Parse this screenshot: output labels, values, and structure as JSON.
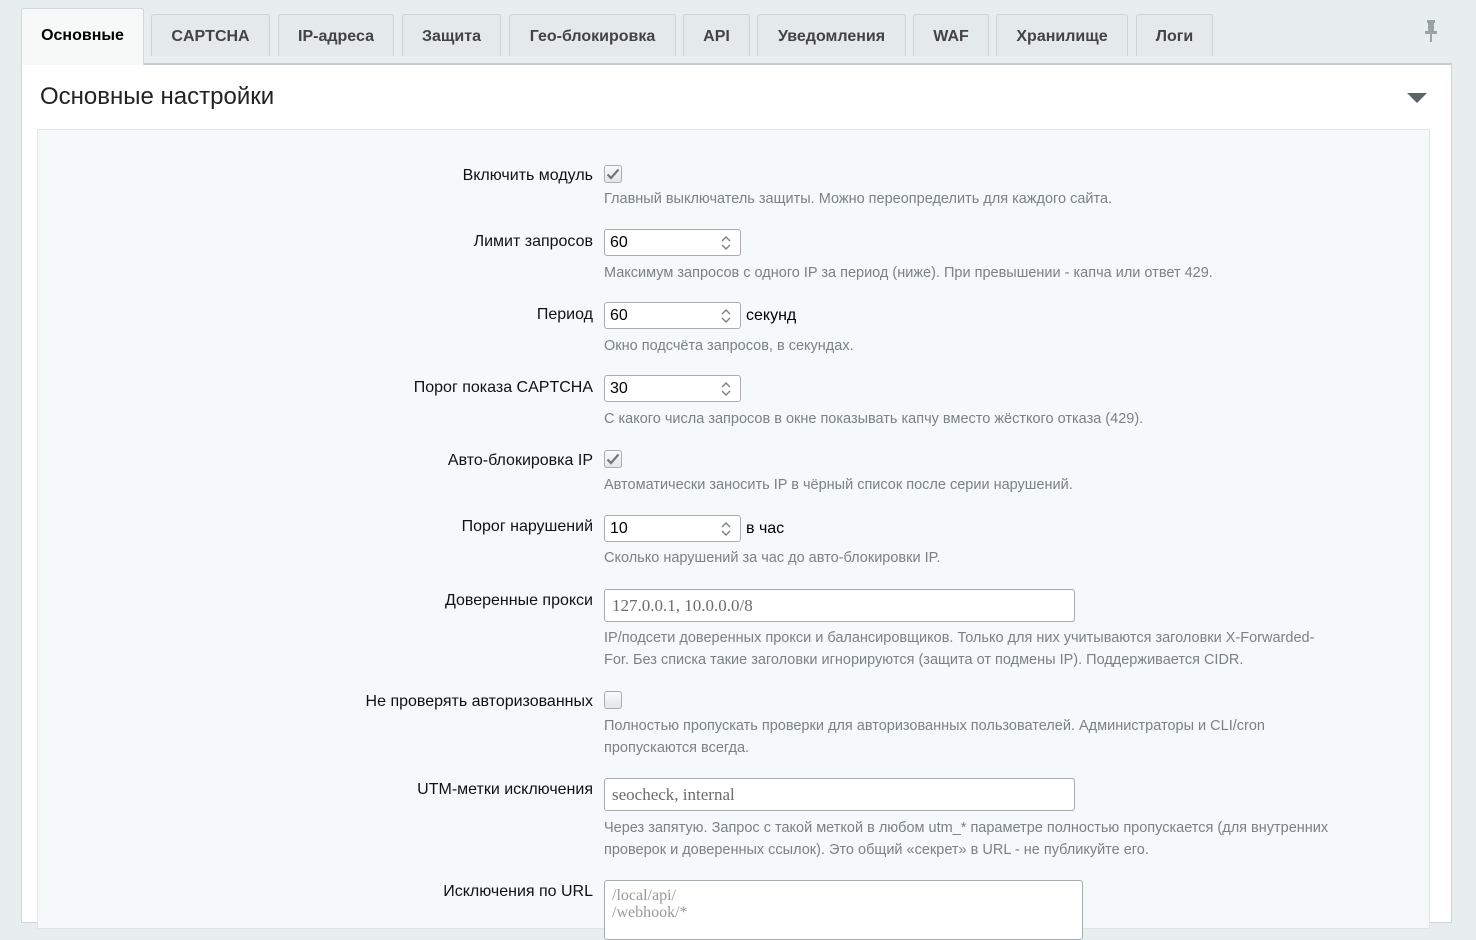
{
  "tabs": [
    {
      "label": "Основные",
      "active": true
    },
    {
      "label": "CAPTCHA"
    },
    {
      "label": "IP-адреса"
    },
    {
      "label": "Защита"
    },
    {
      "label": "Гео-блокировка"
    },
    {
      "label": "API"
    },
    {
      "label": "Уведомления"
    },
    {
      "label": "WAF"
    },
    {
      "label": "Хранилище"
    },
    {
      "label": "Логи"
    }
  ],
  "panel": {
    "title": "Основные настройки"
  },
  "fields": {
    "enable": {
      "label": "Включить модуль",
      "checked": true,
      "hint": "Главный выключатель защиты. Можно переопределить для каждого сайта."
    },
    "limit": {
      "label": "Лимит запросов",
      "value": "60",
      "hint": "Максимум запросов с одного IP за период (ниже). При превышении - капча или ответ 429."
    },
    "period": {
      "label": "Период",
      "value": "60",
      "unit": "секунд",
      "hint": "Окно подсчёта запросов, в секундах."
    },
    "captcha_threshold": {
      "label": "Порог показа CAPTCHA",
      "value": "30",
      "hint": "С какого числа запросов в окне показывать капчу вместо жёсткого отказа (429)."
    },
    "autoblock": {
      "label": "Авто-блокировка IP",
      "checked": true,
      "hint": "Автоматически заносить IP в чёрный список после серии нарушений."
    },
    "violations": {
      "label": "Порог нарушений",
      "value": "10",
      "unit": "в час",
      "hint": "Сколько нарушений за час до авто-блокировки IP."
    },
    "proxies": {
      "label": "Доверенные прокси",
      "value": "127.0.0.1, 10.0.0.0/8",
      "hint1": "IP/подсети доверенных прокси и балансировщиков. Только для них учитываются заголовки X-Forwarded-",
      "hint2": "For. Без списка такие заголовки игнорируются (защита от подмены IP). Поддерживается CIDR."
    },
    "skip_auth": {
      "label": "Не проверять авторизованных",
      "checked": false,
      "hint1": "Полностью пропускать проверки для авторизованных пользователей. Администраторы и CLI/cron",
      "hint2": "пропускаются всегда."
    },
    "utm": {
      "label": "UTM-метки исключения",
      "value": "seocheck, internal",
      "hint1": "Через запятую. Запрос с такой меткой в любом utm_* параметре полностью пропускается (для внутренних",
      "hint2": "проверок и доверенных ссылок). Это общий «секрет» в URL - не публикуйте его."
    },
    "url_exclusions": {
      "label": "Исключения по URL",
      "lines": [
        "/local/api/",
        "/webhook/*"
      ]
    }
  },
  "icons": {
    "pin": "pin-icon",
    "collapse": "collapse-arrow-icon",
    "check": "checkmark-icon",
    "spinner": "spinner-arrows-icon"
  },
  "colors": {
    "background": "#e8edee",
    "hint": "#7a8283",
    "content_bg": "#f5f9f9"
  }
}
